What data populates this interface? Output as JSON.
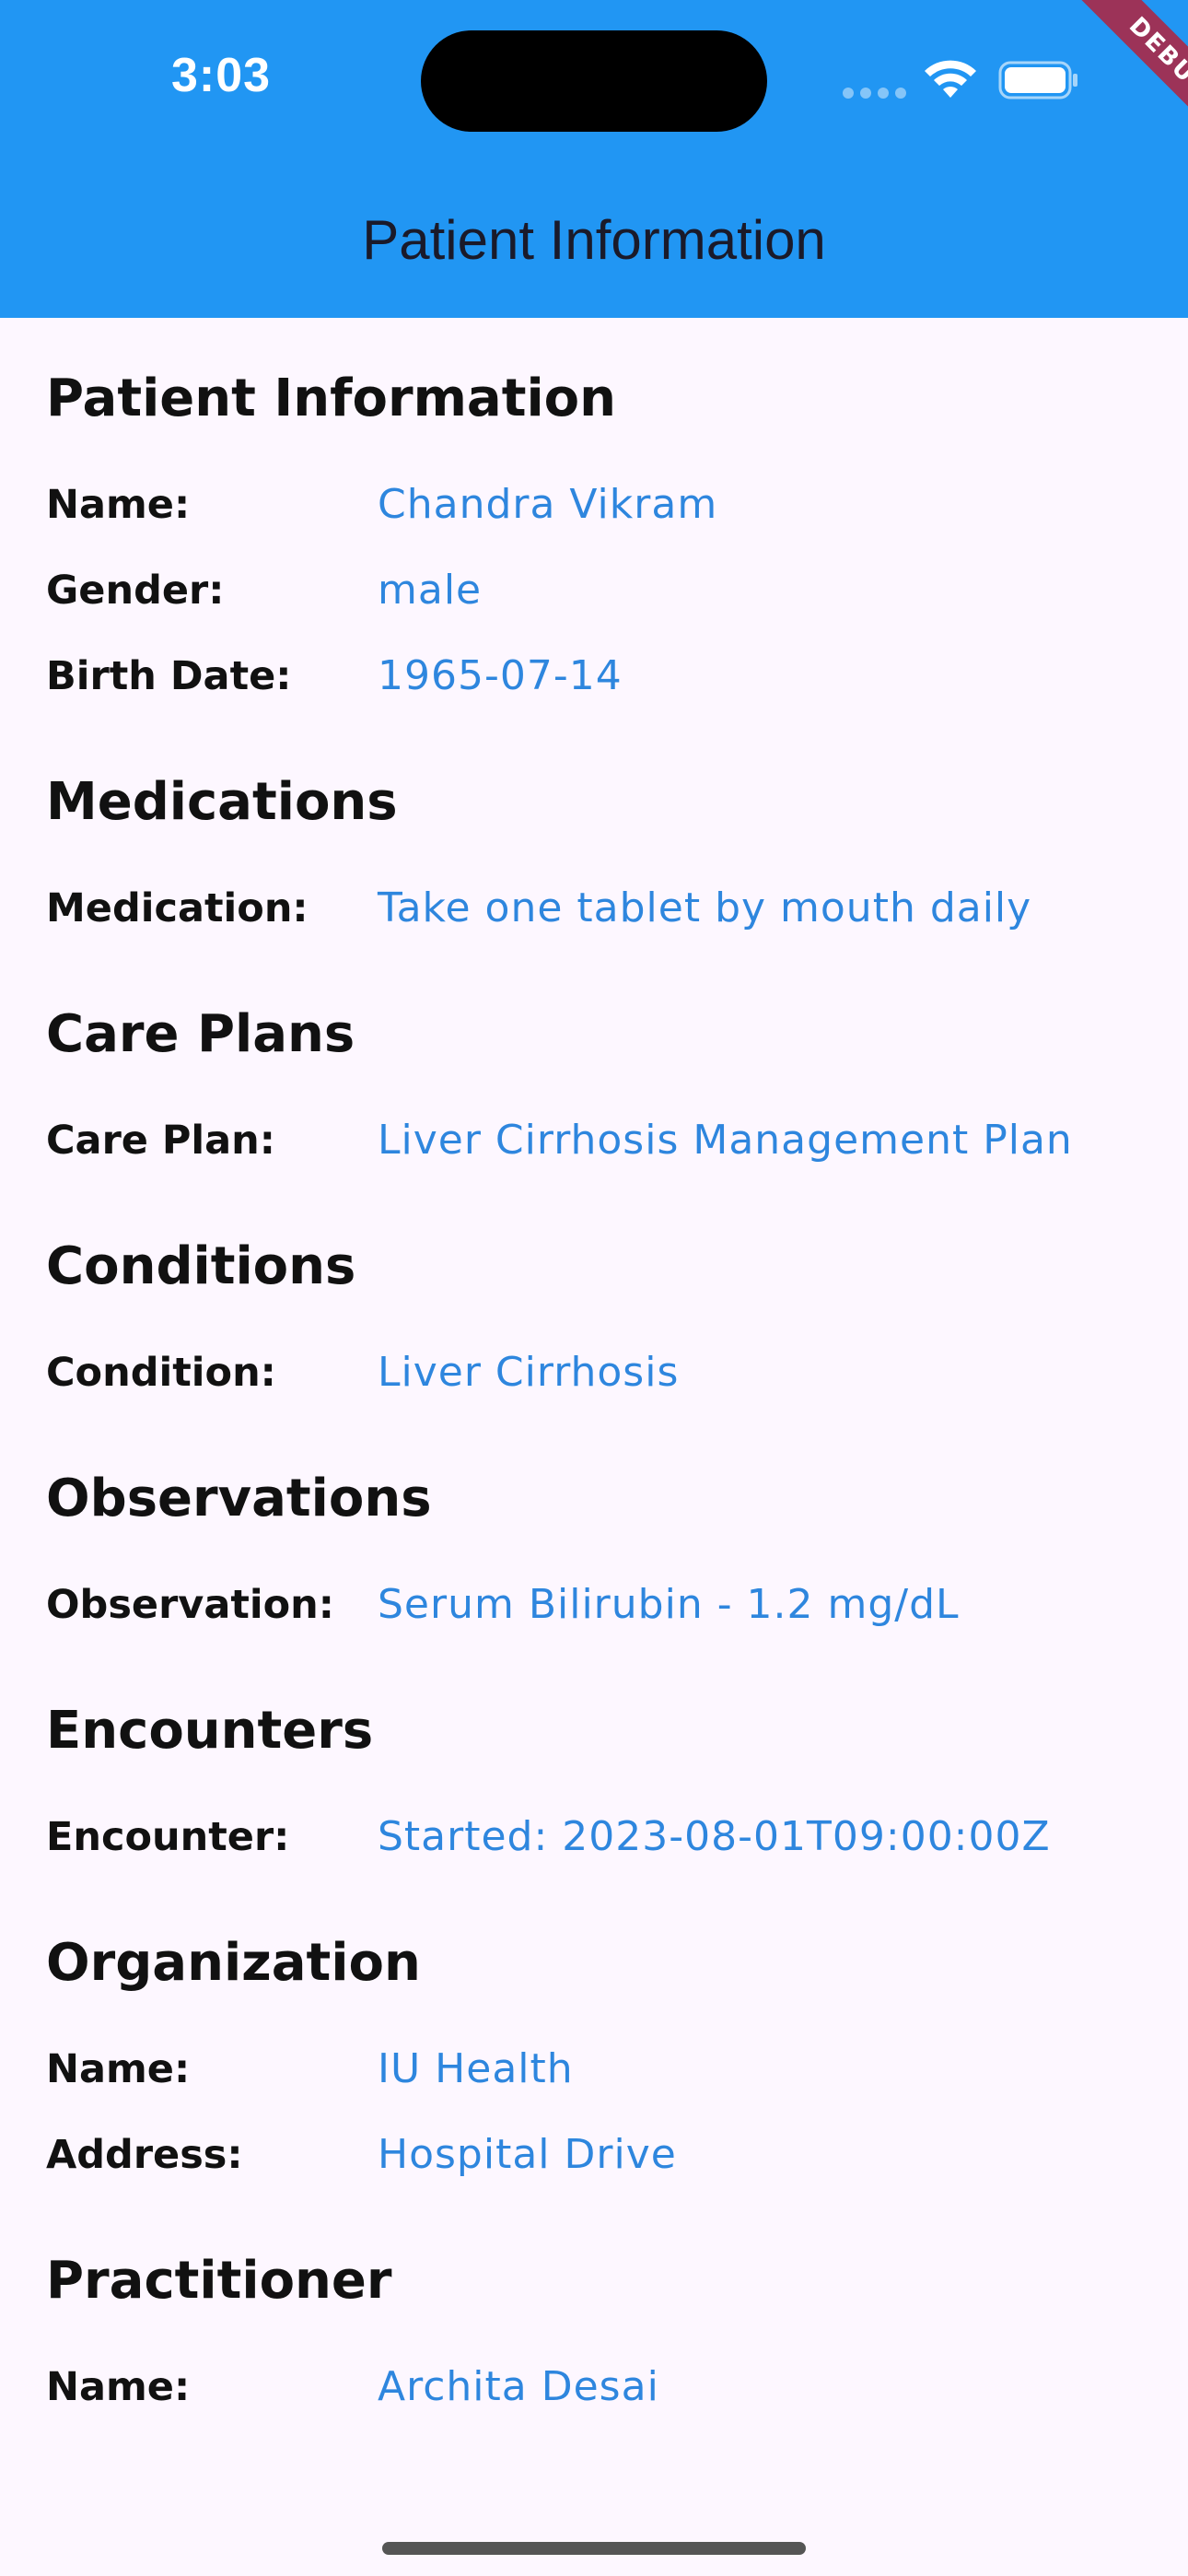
{
  "status_bar": {
    "time": "3:03"
  },
  "app_bar": {
    "title": "Patient Information",
    "debug_label": "DEBUG"
  },
  "sections": {
    "patient": {
      "title": "Patient Information",
      "rows": [
        {
          "label": "Name:",
          "value": "Chandra Vikram"
        },
        {
          "label": "Gender:",
          "value": "male"
        },
        {
          "label": "Birth Date:",
          "value": "1965-07-14"
        }
      ]
    },
    "medications": {
      "title": "Medications",
      "rows": [
        {
          "label": "Medication:",
          "value": "Take one tablet by mouth daily"
        }
      ]
    },
    "care_plans": {
      "title": "Care Plans",
      "rows": [
        {
          "label": "Care Plan:",
          "value": "Liver Cirrhosis Management Plan"
        }
      ]
    },
    "conditions": {
      "title": "Conditions",
      "rows": [
        {
          "label": "Condition:",
          "value": "Liver Cirrhosis"
        }
      ]
    },
    "observations": {
      "title": "Observations",
      "rows": [
        {
          "label": "Observation:",
          "value": "Serum Bilirubin - 1.2 mg/dL"
        }
      ]
    },
    "encounters": {
      "title": "Encounters",
      "rows": [
        {
          "label": "Encounter:",
          "value": "Started: 2023-08-01T09:00:00Z"
        }
      ]
    },
    "organization": {
      "title": "Organization",
      "rows": [
        {
          "label": "Name:",
          "value": "IU Health"
        },
        {
          "label": "Address:",
          "value": "Hospital Drive"
        }
      ]
    },
    "practitioner": {
      "title": "Practitioner",
      "rows": [
        {
          "label": "Name:",
          "value": "Archita Desai"
        }
      ]
    }
  },
  "colors": {
    "app_bar": "#2196F3",
    "background": "#FDF7FF",
    "value_text": "#2E86DE",
    "label_text": "#111111",
    "debug_banner": "#B2223C"
  }
}
